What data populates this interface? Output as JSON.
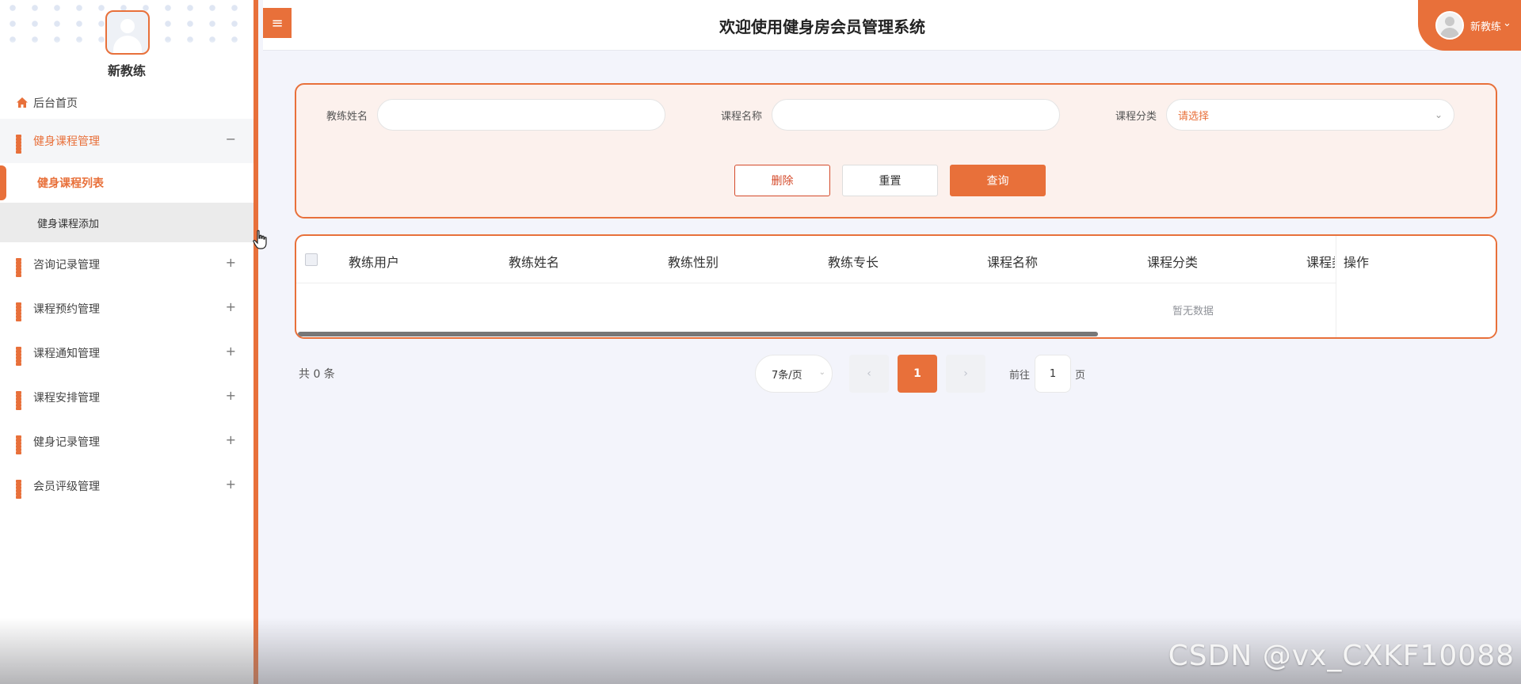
{
  "sidebar": {
    "username": "新教练",
    "home_label": "后台首页",
    "menus": [
      {
        "label": "健身课程管理",
        "toggle": "−",
        "open": true
      },
      {
        "label": "咨询记录管理",
        "toggle": "+"
      },
      {
        "label": "课程预约管理",
        "toggle": "+"
      },
      {
        "label": "课程通知管理",
        "toggle": "+"
      },
      {
        "label": "课程安排管理",
        "toggle": "+"
      },
      {
        "label": "健身记录管理",
        "toggle": "+"
      },
      {
        "label": "会员评级管理",
        "toggle": "+"
      }
    ],
    "submenu": {
      "active": "健身课程列表",
      "other": "健身课程添加"
    }
  },
  "header": {
    "menu_glyph": "≡",
    "title": "欢迎使用健身房会员管理系统",
    "user_label": "新教练",
    "user_chevron": "⌄"
  },
  "search": {
    "coach_name_label": "教练姓名",
    "coach_name_value": "",
    "course_name_label": "课程名称",
    "course_name_value": "",
    "category_label": "课程分类",
    "category_placeholder": "请选择",
    "category_chevron": "⌄",
    "delete_label": "删除",
    "reset_label": "重置",
    "query_label": "查询"
  },
  "table": {
    "columns": [
      "教练用户",
      "教练姓名",
      "教练性别",
      "教练专长",
      "课程名称",
      "课程分类"
    ],
    "clipped_column": "课程类",
    "ops_column": "操作",
    "empty_text": "暂无数据"
  },
  "pagination": {
    "total_text": "共 0 条",
    "page_size_label": "7条/页",
    "page_size_chevron": "⌄",
    "prev_glyph": "‹",
    "current_page": "1",
    "next_glyph": "›",
    "goto_prefix": "前往",
    "goto_value": "1",
    "goto_suffix": "页"
  },
  "watermark": "CSDN @vx_CXKF10088",
  "colors": {
    "accent": "#e8703a",
    "panel_bg": "#fcf1ed",
    "page_bg": "#f3f4fb"
  }
}
